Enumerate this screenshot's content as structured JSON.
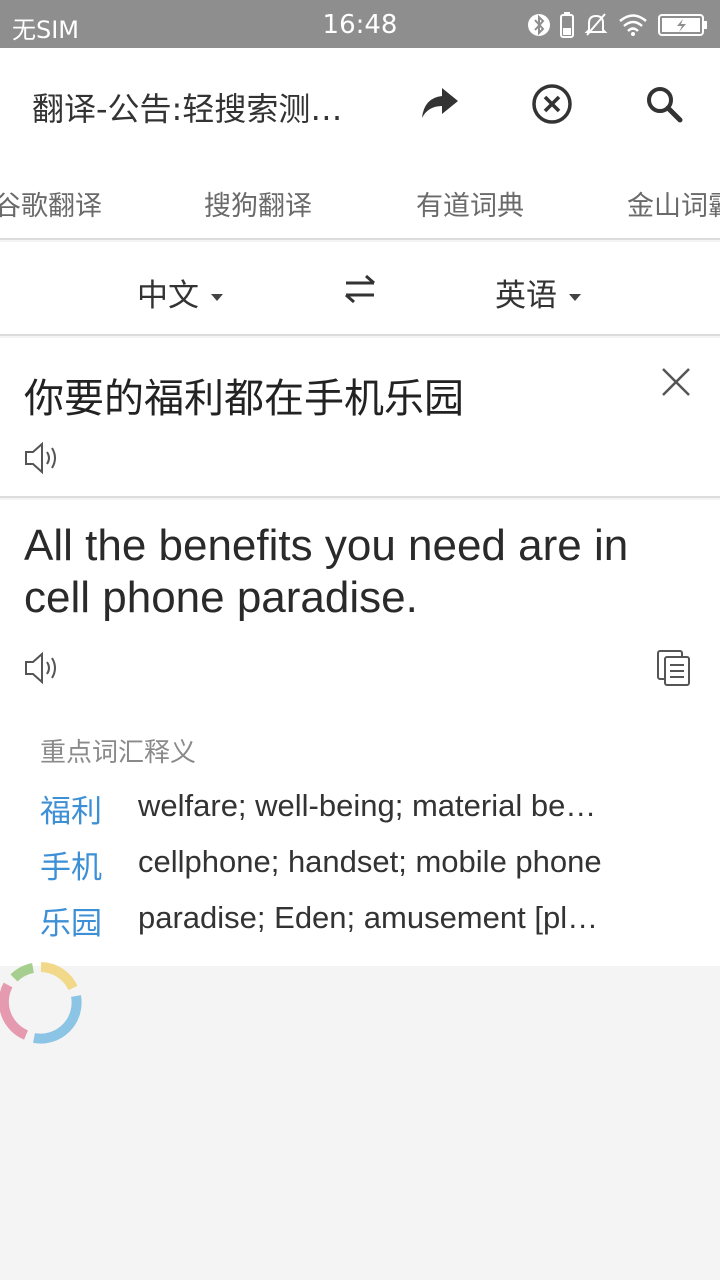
{
  "status_bar": {
    "carrier": "无SIM",
    "time": "16:48"
  },
  "header": {
    "title": "翻译-公告:轻搜索测…"
  },
  "tabs": [
    {
      "label": "谷歌翻译"
    },
    {
      "label": "搜狗翻译"
    },
    {
      "label": "有道词典"
    },
    {
      "label": "金山词霸"
    }
  ],
  "languages": {
    "source": "中文",
    "target": "英语"
  },
  "input": {
    "text": "你要的福利都在手机乐园"
  },
  "result": {
    "text": "All the benefits you need are in cell phone paradise."
  },
  "vocabulary": {
    "title": "重点词汇释义",
    "items": [
      {
        "word": "福利",
        "definition": "welfare; well-being; material be…"
      },
      {
        "word": "手机",
        "definition": "cellphone; handset; mobile phone"
      },
      {
        "word": "乐园",
        "definition": "paradise; Eden; amusement [pl…"
      }
    ]
  },
  "colors": {
    "accent": "#3d8fd6",
    "status_bar": "#8e8e8e",
    "background": "#f4f4f4"
  }
}
